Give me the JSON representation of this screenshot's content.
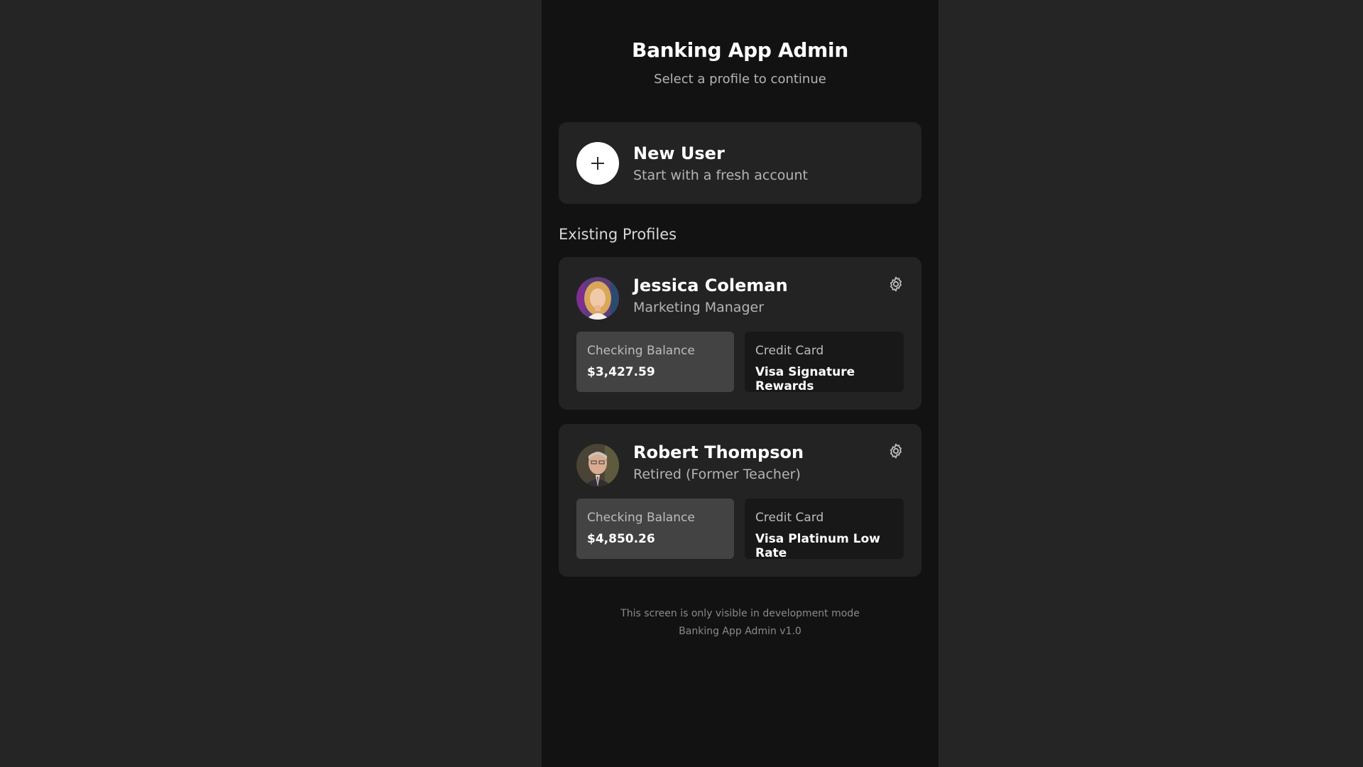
{
  "header": {
    "title": "Banking App Admin",
    "subtitle": "Select a profile to continue"
  },
  "new_user": {
    "title": "New User",
    "subtitle": "Start with a fresh account",
    "icon": "plus-icon"
  },
  "section_label": "Existing Profiles",
  "profiles": [
    {
      "name": "Jessica Coleman",
      "role": "Marketing Manager",
      "balance_label": "Checking Balance",
      "balance": "$3,427.59",
      "card_label": "Credit Card",
      "card": "Visa Signature Rewards",
      "settings_icon": "gear-icon"
    },
    {
      "name": "Robert Thompson",
      "role": "Retired (Former Teacher)",
      "balance_label": "Checking Balance",
      "balance": "$4,850.26",
      "card_label": "Credit Card",
      "card": "Visa Platinum Low Rate",
      "settings_icon": "gear-icon"
    }
  ],
  "footer": {
    "line1": "This screen is only visible in development mode",
    "line2": "Banking App Admin v1.0"
  },
  "colors": {
    "outer_background": "#252525",
    "screen_background": "#121212",
    "card_background": "#232323",
    "balance_tile": "#434343",
    "credit_tile": "#181818"
  }
}
